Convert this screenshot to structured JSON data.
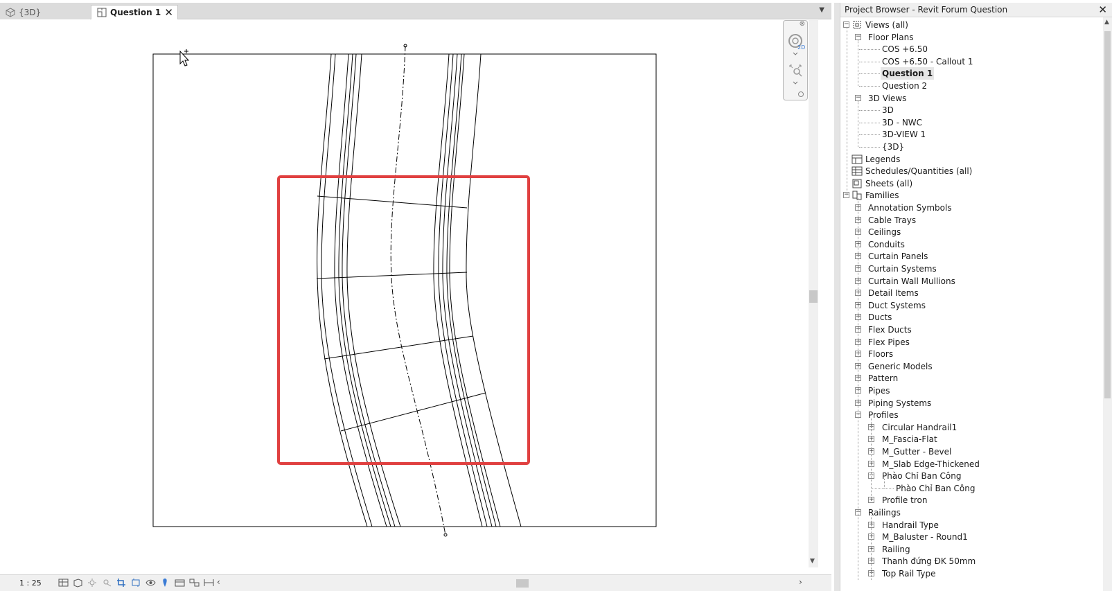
{
  "tabs": [
    {
      "label": "{3D}"
    },
    {
      "label": "Question 1"
    }
  ],
  "status_bar": {
    "scale": "1 : 25"
  },
  "project_browser": {
    "title": "Project Browser - Revit Forum Question",
    "tree": [
      {
        "label": "Views (all)",
        "level": 0,
        "toggle": "minus",
        "icon": "views-icon"
      },
      {
        "label": "Floor Plans",
        "level": 1,
        "toggle": "minus"
      },
      {
        "label": "COS +6.50",
        "level": 2
      },
      {
        "label": "COS +6.50 - Callout 1",
        "level": 2
      },
      {
        "label": "Question 1",
        "level": 2,
        "selected": true
      },
      {
        "label": "Question 2",
        "level": 2
      },
      {
        "label": "3D Views",
        "level": 1,
        "toggle": "minus"
      },
      {
        "label": "3D",
        "level": 2
      },
      {
        "label": "3D - NWC",
        "level": 2
      },
      {
        "label": "3D-VIEW 1",
        "level": 2
      },
      {
        "label": "{3D}",
        "level": 2
      },
      {
        "label": "Legends",
        "level": 0,
        "icon": "legends-icon"
      },
      {
        "label": "Schedules/Quantities (all)",
        "level": 0,
        "icon": "schedules-icon"
      },
      {
        "label": "Sheets (all)",
        "level": 0,
        "icon": "sheets-icon"
      },
      {
        "label": "Families",
        "level": 0,
        "toggle": "minus",
        "icon": "families-icon"
      },
      {
        "label": "Annotation Symbols",
        "level": 1,
        "toggle": "plus"
      },
      {
        "label": "Cable Trays",
        "level": 1,
        "toggle": "plus"
      },
      {
        "label": "Ceilings",
        "level": 1,
        "toggle": "plus"
      },
      {
        "label": "Conduits",
        "level": 1,
        "toggle": "plus"
      },
      {
        "label": "Curtain Panels",
        "level": 1,
        "toggle": "plus"
      },
      {
        "label": "Curtain Systems",
        "level": 1,
        "toggle": "plus"
      },
      {
        "label": "Curtain Wall Mullions",
        "level": 1,
        "toggle": "plus"
      },
      {
        "label": "Detail Items",
        "level": 1,
        "toggle": "plus"
      },
      {
        "label": "Duct Systems",
        "level": 1,
        "toggle": "plus"
      },
      {
        "label": "Ducts",
        "level": 1,
        "toggle": "plus"
      },
      {
        "label": "Flex Ducts",
        "level": 1,
        "toggle": "plus"
      },
      {
        "label": "Flex Pipes",
        "level": 1,
        "toggle": "plus"
      },
      {
        "label": "Floors",
        "level": 1,
        "toggle": "plus"
      },
      {
        "label": "Generic Models",
        "level": 1,
        "toggle": "plus"
      },
      {
        "label": "Pattern",
        "level": 1,
        "toggle": "plus"
      },
      {
        "label": "Pipes",
        "level": 1,
        "toggle": "plus"
      },
      {
        "label": "Piping Systems",
        "level": 1,
        "toggle": "plus"
      },
      {
        "label": "Profiles",
        "level": 1,
        "toggle": "minus"
      },
      {
        "label": "Circular Handrail1",
        "level": 2,
        "toggle": "plus"
      },
      {
        "label": "M_Fascia-Flat",
        "level": 2,
        "toggle": "plus"
      },
      {
        "label": "M_Gutter - Bevel",
        "level": 2,
        "toggle": "plus"
      },
      {
        "label": "M_Slab Edge-Thickened",
        "level": 2,
        "toggle": "plus"
      },
      {
        "label": "Phào Chỉ Ban Công",
        "level": 2,
        "toggle": "minus"
      },
      {
        "label": "Phào Chỉ Ban Công",
        "level": 3
      },
      {
        "label": "Profile tron",
        "level": 2,
        "toggle": "plus"
      },
      {
        "label": "Railings",
        "level": 1,
        "toggle": "minus"
      },
      {
        "label": "Handrail Type",
        "level": 2,
        "toggle": "plus"
      },
      {
        "label": "M_Baluster - Round1",
        "level": 2,
        "toggle": "plus"
      },
      {
        "label": "Railing",
        "level": 2,
        "toggle": "plus"
      },
      {
        "label": "Thanh đứng ĐK 50mm",
        "level": 2,
        "toggle": "plus"
      },
      {
        "label": "Top Rail Type",
        "level": 2,
        "toggle": "plus"
      }
    ]
  },
  "colors": {
    "highlight_rectangle": "#e04040",
    "tab_bar": "#dcdcdc",
    "selection": "#e6e6e6"
  }
}
